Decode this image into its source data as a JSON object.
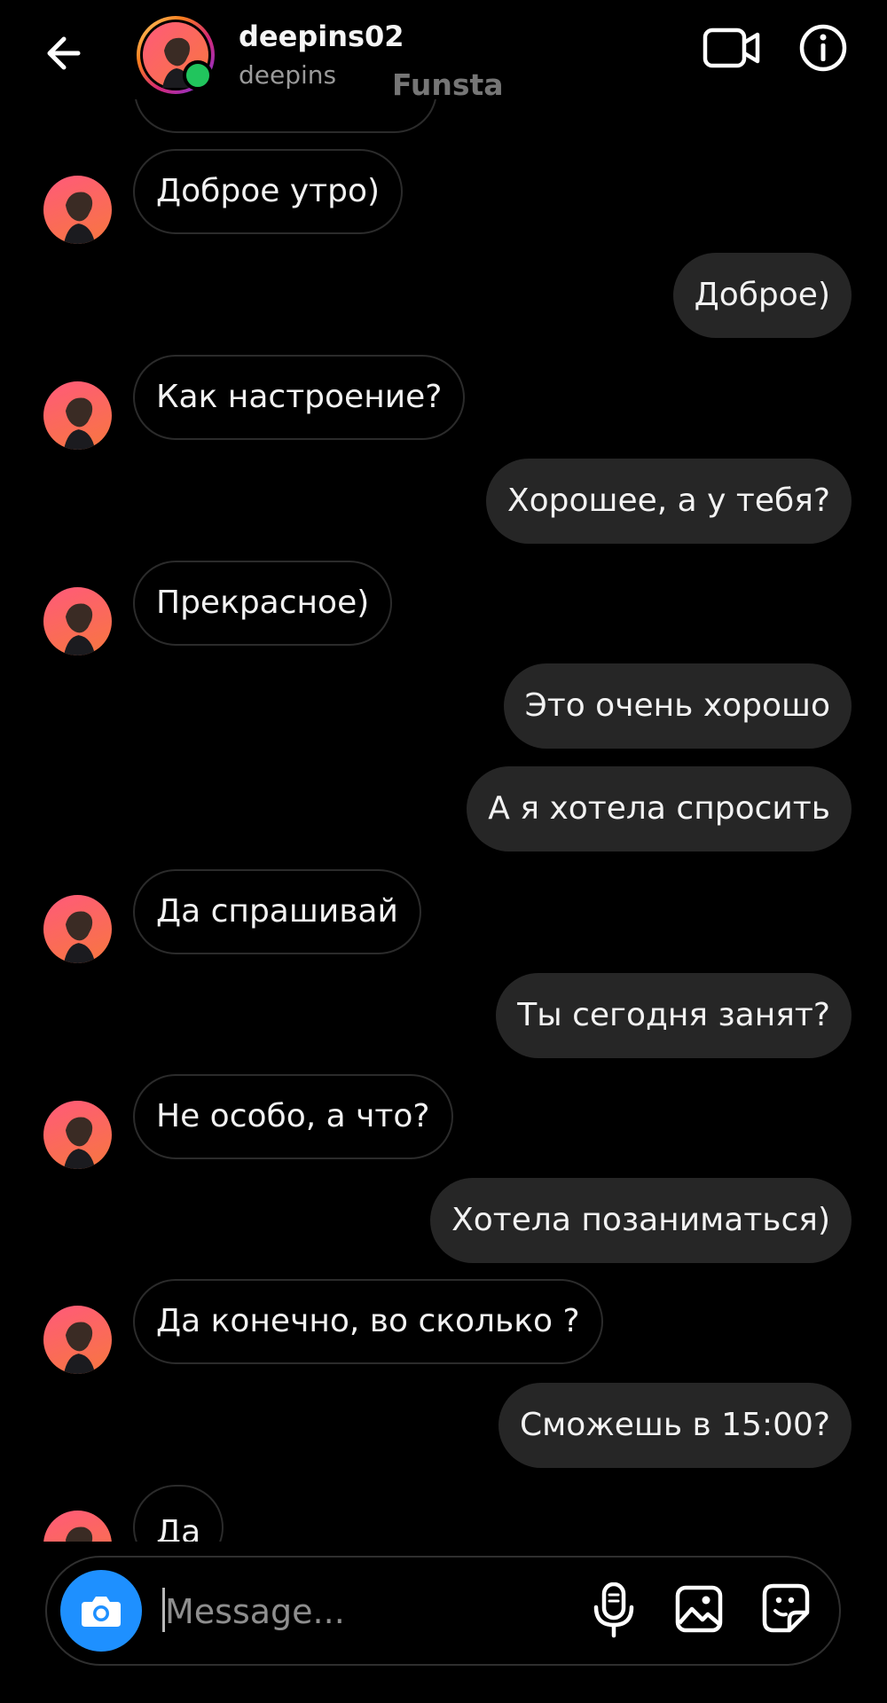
{
  "header": {
    "username": "deepins02",
    "handle": "deepins",
    "watermark": "Funsta"
  },
  "messages": [
    {
      "side": "received",
      "text": "Доброе утро)"
    },
    {
      "side": "sent",
      "text": "Доброе)"
    },
    {
      "side": "received",
      "text": "Как настроение?"
    },
    {
      "side": "sent",
      "text": "Хорошее, а у тебя?"
    },
    {
      "side": "received",
      "text": "Прекрасное)"
    },
    {
      "side": "sent",
      "text": "Это очень хорошо"
    },
    {
      "side": "sent",
      "text": "А я хотела спросить"
    },
    {
      "side": "received",
      "text": "Да спрашивай"
    },
    {
      "side": "sent",
      "text": "Ты сегодня занят?"
    },
    {
      "side": "received",
      "text": "Не особо, а что?"
    },
    {
      "side": "sent",
      "text": "Хотела позаниматься)"
    },
    {
      "side": "received",
      "text": "Да конечно, во сколько ?"
    },
    {
      "side": "sent",
      "text": "Сможешь в 15:00?"
    },
    {
      "side": "received",
      "text": "Да"
    }
  ],
  "composer": {
    "placeholder": "Message..."
  },
  "icons": {
    "back": "arrow-left-icon",
    "video": "video-camera-icon",
    "info": "info-icon",
    "camera": "camera-icon",
    "mic": "microphone-icon",
    "gallery": "image-icon",
    "sticker": "sticker-icon"
  },
  "colors": {
    "background": "#000000",
    "sent_bubble": "#262626",
    "received_border": "#2b2b2b",
    "camera_button": "#1e90ff",
    "online_dot": "#21c55d"
  }
}
